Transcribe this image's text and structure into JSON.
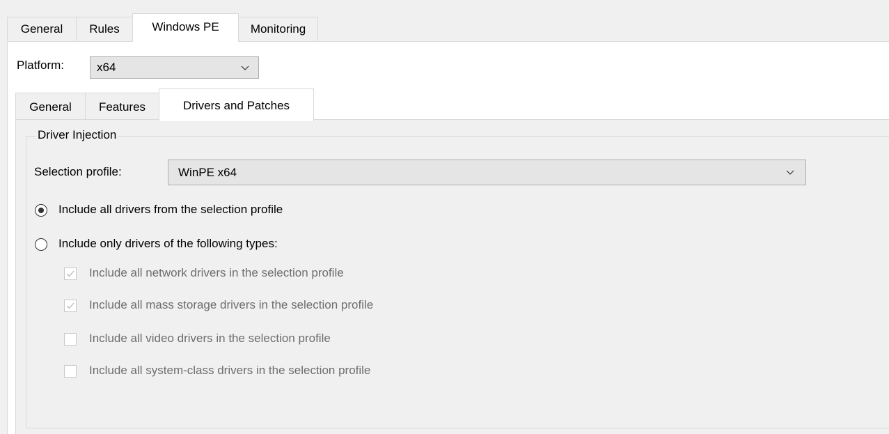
{
  "outer_tabs": [
    "General",
    "Rules",
    "Windows PE",
    "Monitoring"
  ],
  "outer_active": "Windows PE",
  "platform": {
    "label": "Platform:",
    "value": "x64"
  },
  "inner_tabs": [
    "General",
    "Features",
    "Drivers and Patches"
  ],
  "inner_active": "Drivers and Patches",
  "driver_injection": {
    "group_title": "Driver Injection",
    "selection_profile": {
      "label": "Selection profile:",
      "value": "WinPE x64"
    },
    "radio_all": {
      "label": "Include all drivers from the selection profile",
      "selected": true
    },
    "radio_types": {
      "label": "Include only drivers of the following types:",
      "selected": false
    },
    "checkboxes": [
      {
        "label": "Include all network drivers in the selection profile",
        "checked": true,
        "enabled": false
      },
      {
        "label": "Include all mass storage drivers in the selection profile",
        "checked": true,
        "enabled": false
      },
      {
        "label": "Include all video drivers in the selection profile",
        "checked": false,
        "enabled": false
      },
      {
        "label": "Include all system-class drivers in the selection profile",
        "checked": false,
        "enabled": false
      }
    ]
  },
  "icons": {
    "dropdown": "chevron-down-icon",
    "check": "checkmark-icon"
  }
}
